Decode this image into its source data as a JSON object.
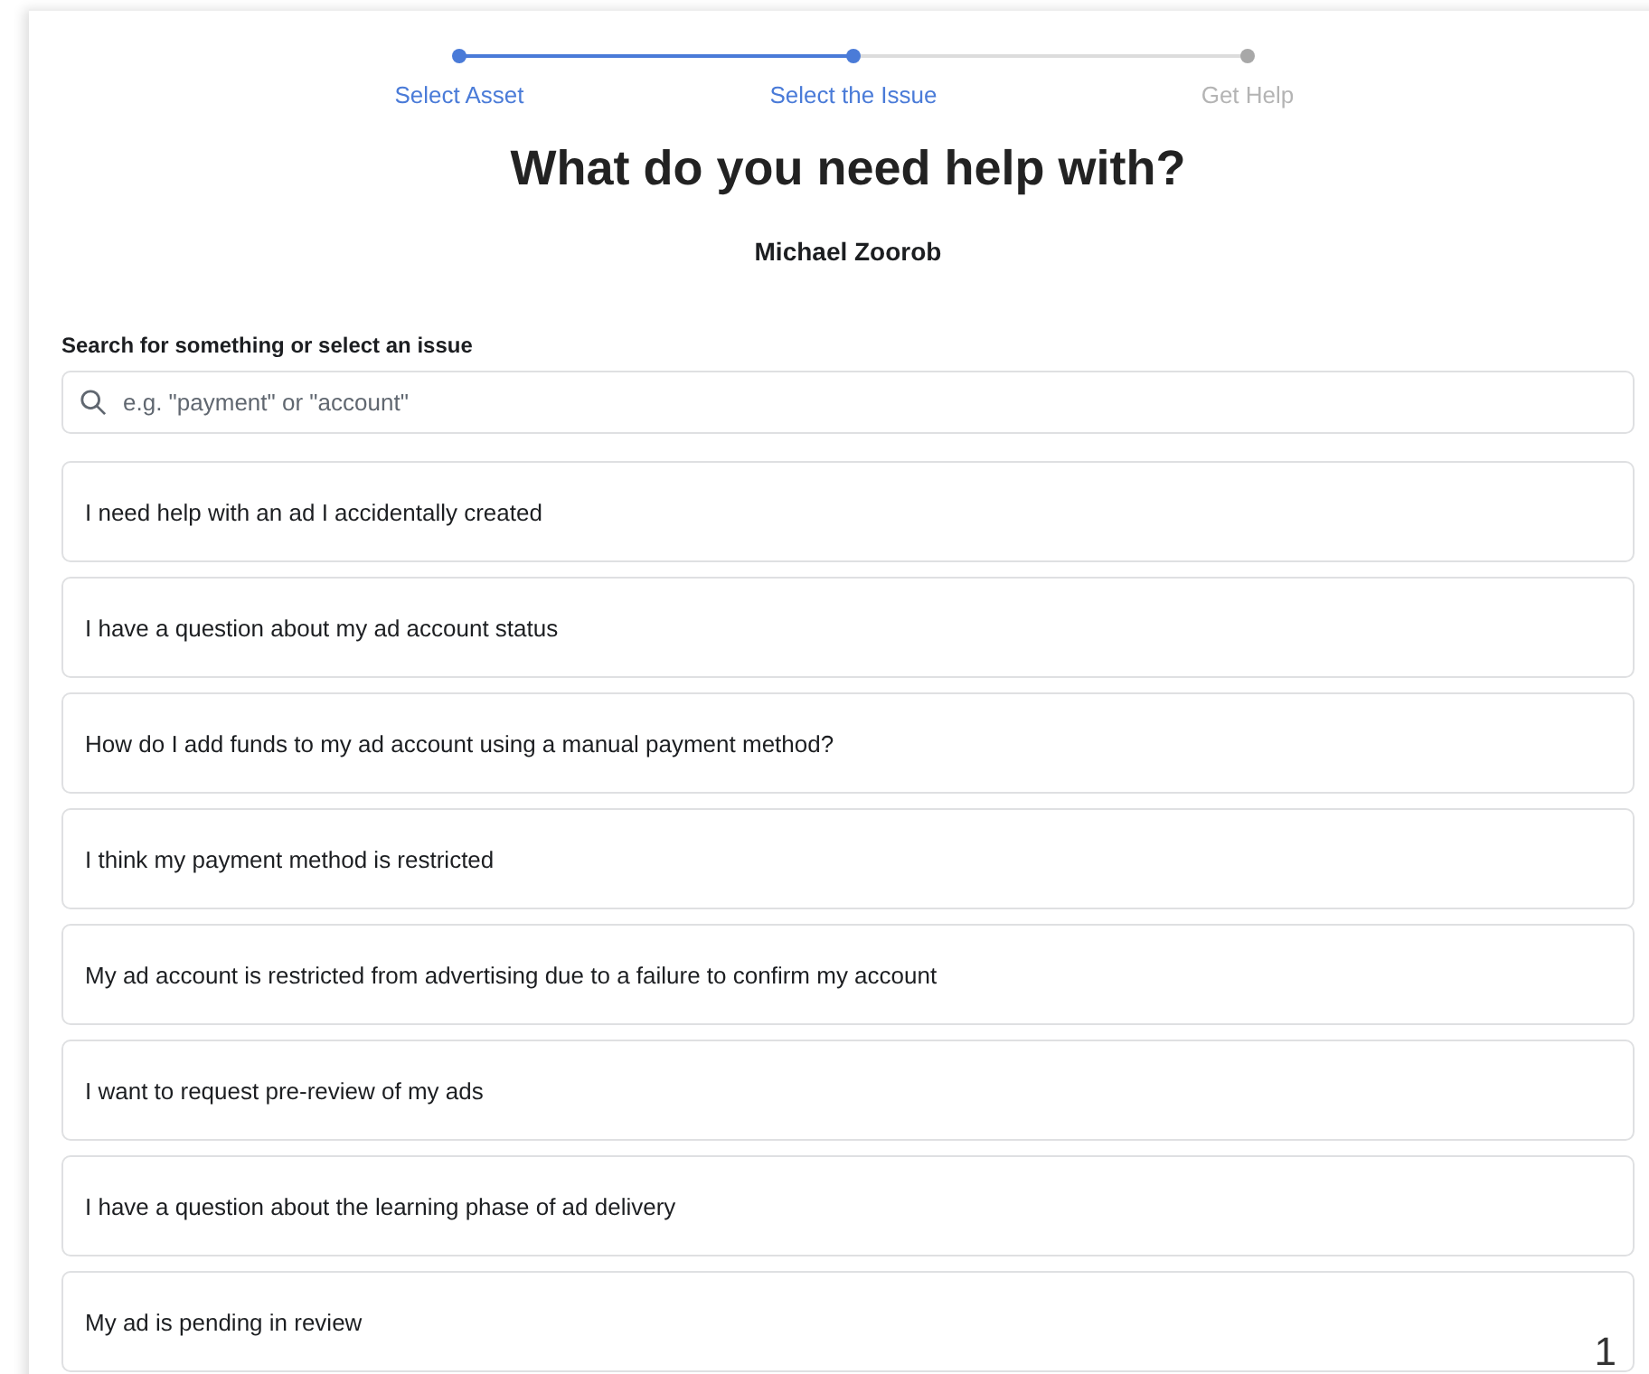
{
  "stepper": {
    "steps": [
      {
        "label": "Select Asset",
        "active": true
      },
      {
        "label": "Select the Issue",
        "active": true
      },
      {
        "label": "Get Help",
        "active": false
      }
    ]
  },
  "title": "What do you need help with?",
  "account_name": "Michael Zoorob",
  "search": {
    "label": "Search for something or select an issue",
    "placeholder": "e.g. \"payment\" or \"account\""
  },
  "issues": [
    "I need help with an ad I accidentally created",
    "I have a question about my ad account status",
    "How do I add funds to my ad account using a manual payment method?",
    "I think my payment method is restricted",
    "My ad account is restricted from advertising due to a failure to confirm my account",
    "I want to request pre-review of my ads",
    "I have a question about the learning phase of ad delivery",
    "My ad is pending in review"
  ],
  "page_number": "1"
}
